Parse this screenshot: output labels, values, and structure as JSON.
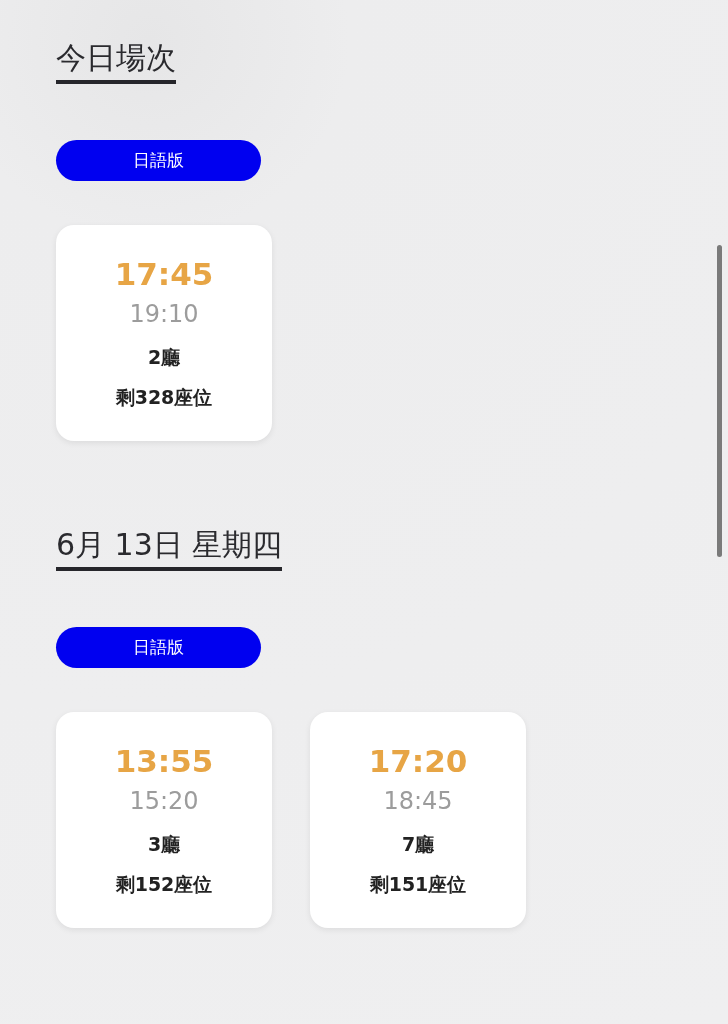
{
  "sections": [
    {
      "heading": "今日場次",
      "version": "日語版",
      "showtimes": [
        {
          "start": "17:45",
          "end": "19:10",
          "hall": "2廳",
          "seats": "剩328座位"
        }
      ]
    },
    {
      "heading": "6月 13日 星期四",
      "version": "日語版",
      "showtimes": [
        {
          "start": "13:55",
          "end": "15:20",
          "hall": "3廳",
          "seats": "剩152座位"
        },
        {
          "start": "17:20",
          "end": "18:45",
          "hall": "7廳",
          "seats": "剩151座位"
        }
      ]
    }
  ]
}
